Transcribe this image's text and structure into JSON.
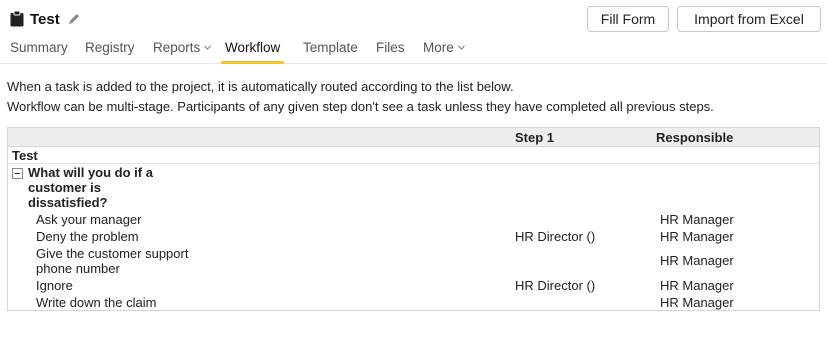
{
  "header": {
    "title": "Test",
    "icon": "clipboard-icon",
    "edit_icon": "pencil-icon",
    "fill_form_label": "Fill Form",
    "import_label": "Import from Excel"
  },
  "tabs": [
    {
      "label": "Summary",
      "active": false
    },
    {
      "label": "Registry",
      "active": false
    },
    {
      "label": "Reports",
      "active": false,
      "dropdown": true
    },
    {
      "label": "Workflow",
      "active": true
    },
    {
      "label": "Template",
      "active": false
    },
    {
      "label": "Files",
      "active": false
    },
    {
      "label": "More",
      "active": false,
      "dropdown": true
    }
  ],
  "description": {
    "line1": "When a task is added to the project, it is automatically routed according to the list below.",
    "line2": "Workflow can be multi-stage. Participants of any given step don't see a task unless they have completed all previous steps."
  },
  "table": {
    "columns": {
      "step": "Step 1",
      "responsible": "Responsible"
    },
    "group": "Test",
    "question": "What will you do if a customer is dissatisfied?",
    "options": [
      {
        "label": "Ask your manager",
        "step": "",
        "responsible": "HR Manager"
      },
      {
        "label": "Deny the problem",
        "step": "HR Director ()",
        "responsible": "HR Manager"
      },
      {
        "label": "Give the customer support phone number",
        "step": "",
        "responsible": "HR Manager"
      },
      {
        "label": "Ignore",
        "step": "HR Director ()",
        "responsible": "HR Manager"
      },
      {
        "label": "Write down the claim",
        "step": "",
        "responsible": "HR Manager"
      }
    ]
  },
  "colors": {
    "active_tab_underline": "#f2c32f",
    "header_bg": "#eeeeee",
    "border": "#d6d6d6"
  }
}
